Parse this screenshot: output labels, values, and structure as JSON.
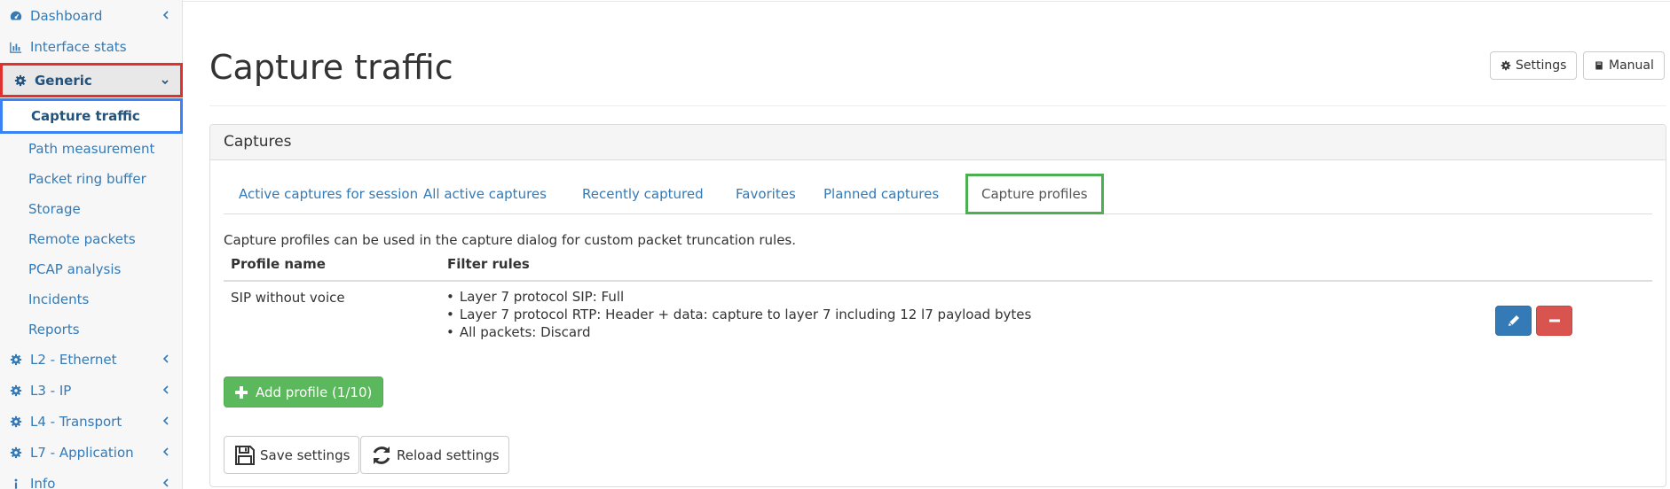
{
  "sidebar": {
    "items": [
      {
        "label": "Dashboard",
        "icon": "dashboard-icon"
      },
      {
        "label": "Interface stats",
        "icon": "bar-chart-icon"
      },
      {
        "label": "Generic",
        "icon": "gear-icon"
      },
      {
        "label": "L2 - Ethernet",
        "icon": "gear-icon"
      },
      {
        "label": "L3 - IP",
        "icon": "gear-icon"
      },
      {
        "label": "L4 - Transport",
        "icon": "gear-icon"
      },
      {
        "label": "L7 - Application",
        "icon": "gear-icon"
      },
      {
        "label": "Info",
        "icon": "info-icon"
      }
    ],
    "generic_children": [
      "Capture traffic",
      "Path measurement",
      "Packet ring buffer",
      "Storage",
      "Remote packets",
      "PCAP analysis",
      "Incidents",
      "Reports"
    ]
  },
  "header": {
    "title": "Capture traffic",
    "settings_label": "Settings",
    "manual_label": "Manual"
  },
  "panel": {
    "title": "Captures",
    "tabs": [
      "Active captures for session",
      "All active captures",
      "Recently captured",
      "Favorites",
      "Planned captures",
      "Capture profiles"
    ],
    "description": "Capture profiles can be used in the capture dialog for custom packet truncation rules.",
    "columns": [
      "Profile name",
      "Filter rules"
    ],
    "rows": [
      {
        "name": "SIP without voice",
        "rules": [
          "Layer 7 protocol SIP: Full",
          "Layer 7 protocol RTP: Header + data: capture to layer 7 including 12 l7 payload bytes",
          "All packets: Discard"
        ]
      }
    ],
    "add_label": "Add profile (1/10)",
    "save_label": "Save settings",
    "reload_label": "Reload settings"
  },
  "colors": {
    "link": "#337ab7",
    "primary": "#337ab7",
    "danger": "#d9534f",
    "success": "#5cb85c",
    "highlight_red": "#e03030",
    "highlight_blue": "#3b82f6",
    "highlight_green": "#4caf50"
  }
}
